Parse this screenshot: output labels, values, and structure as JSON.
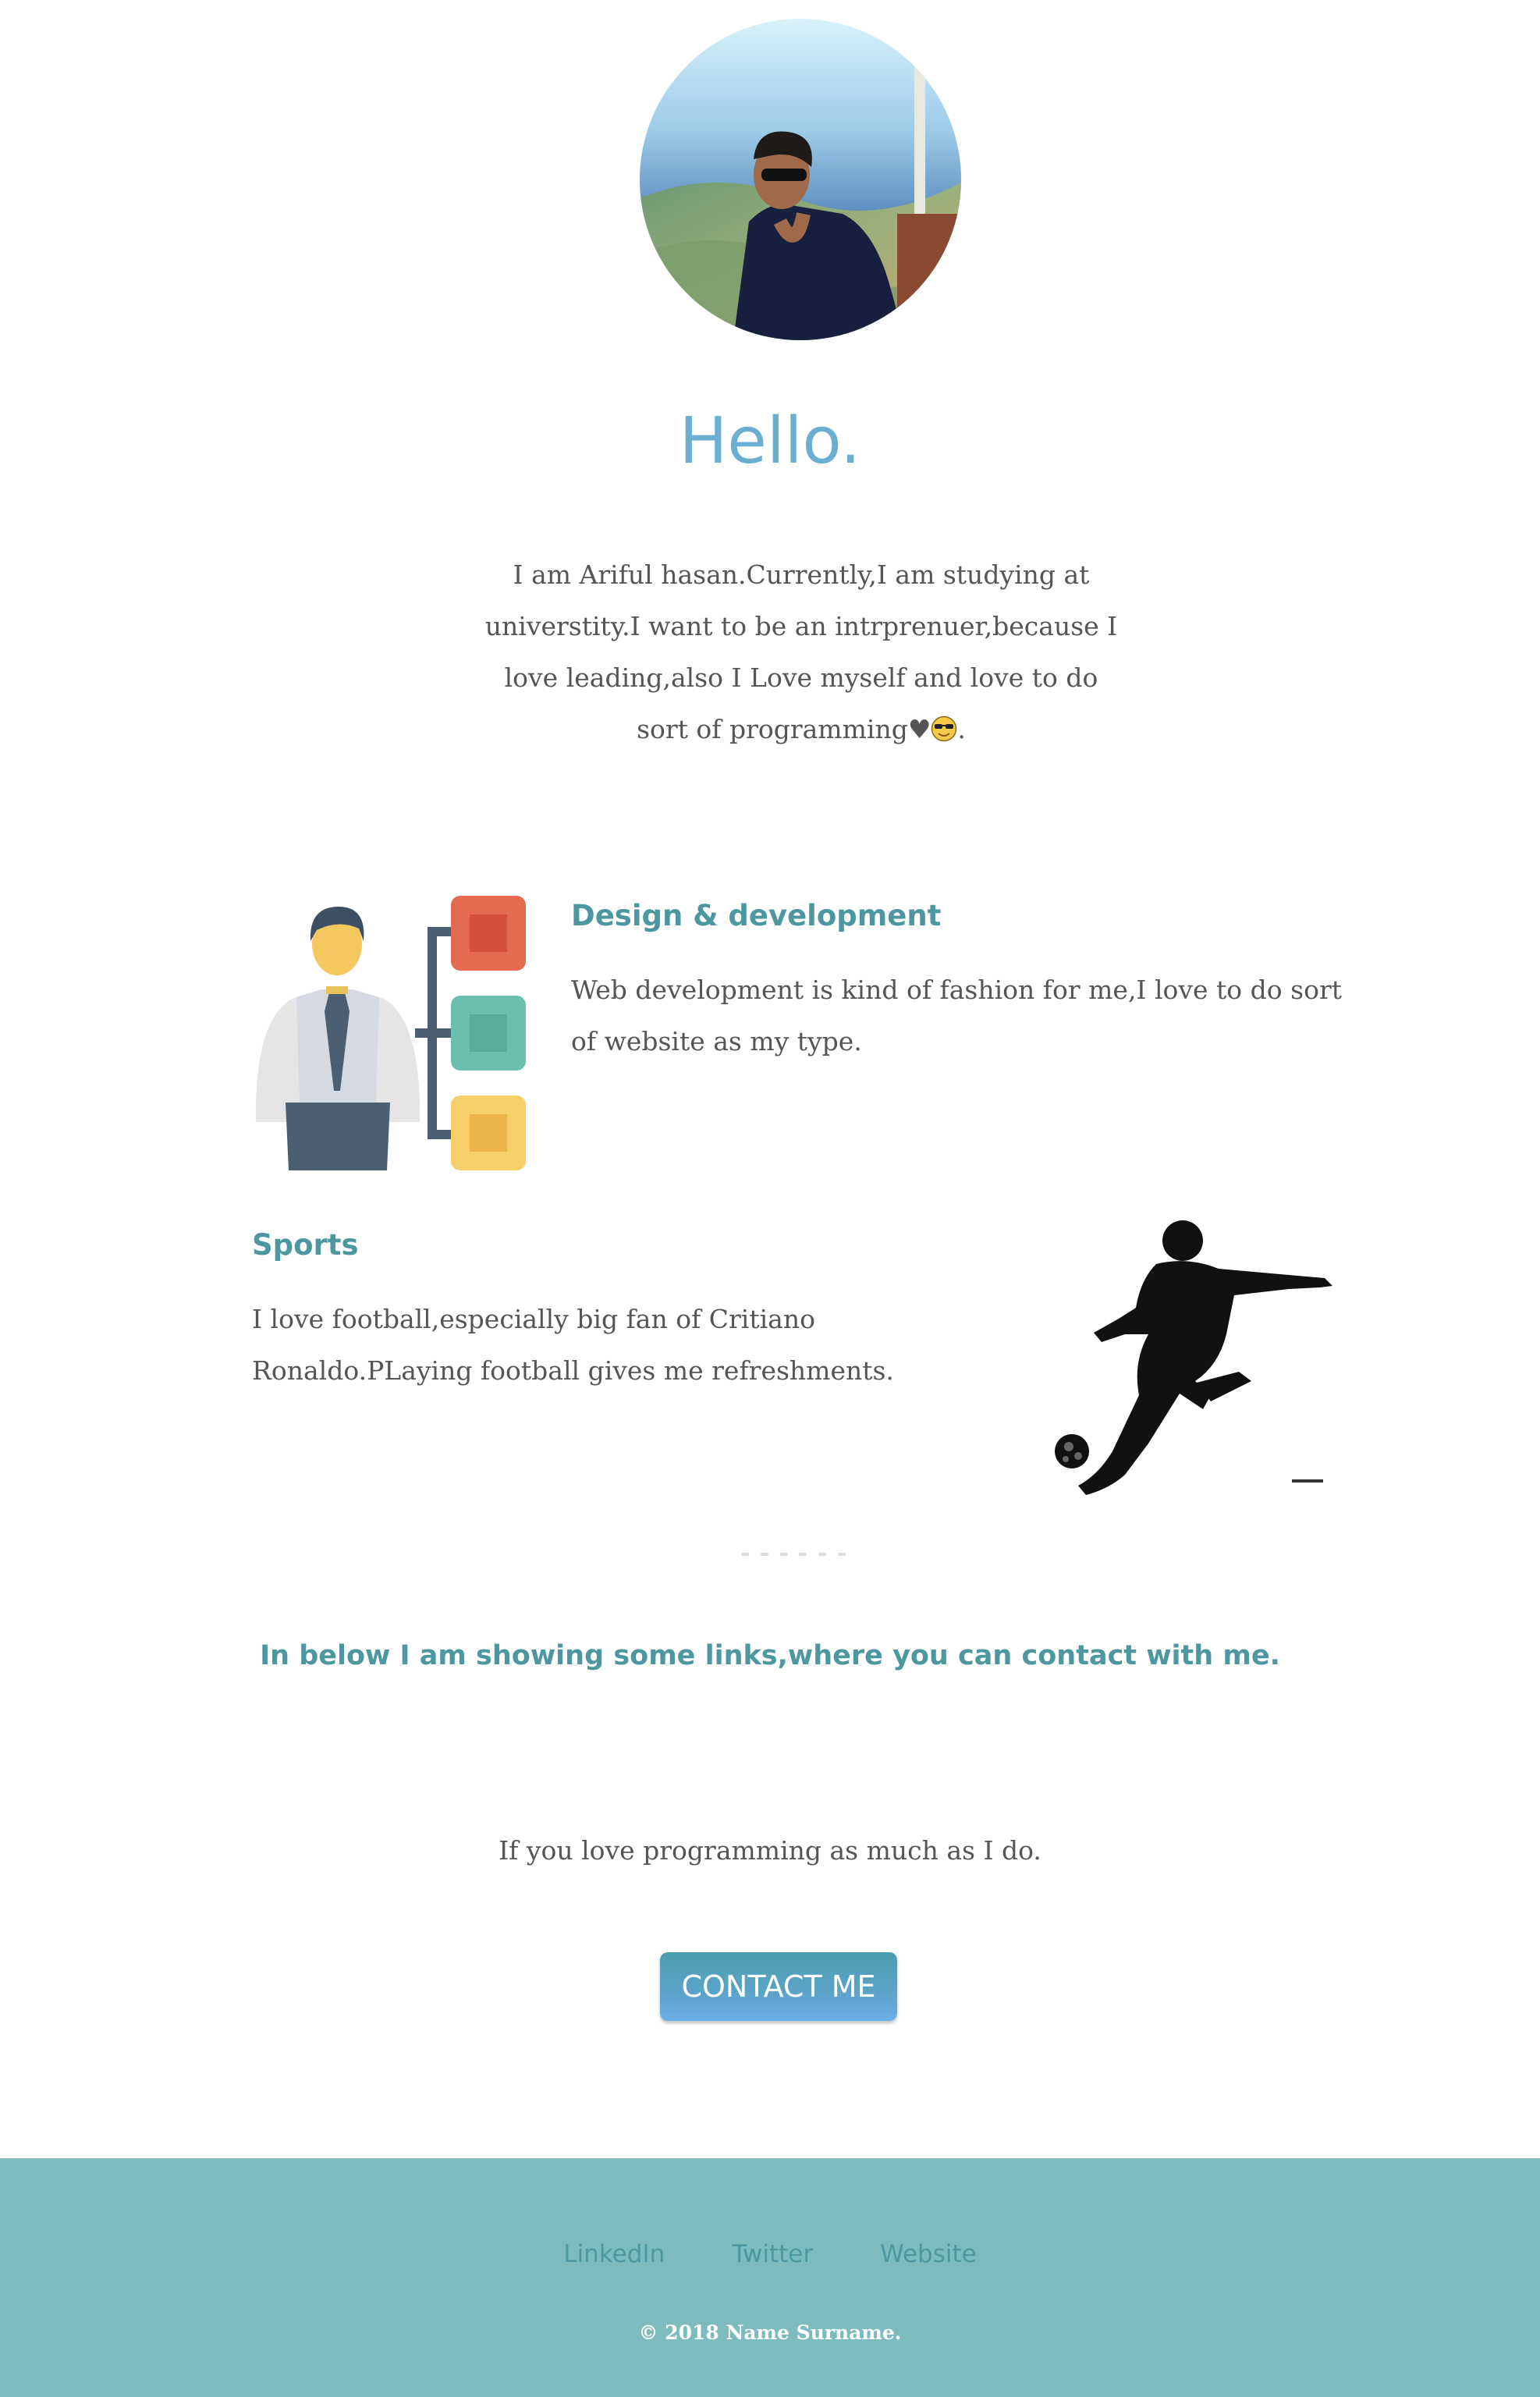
{
  "profile": {
    "photo_alt": "Profile photo",
    "heading": "Hello.",
    "bio": "I am Ariful hasan.Currently,I am studying at universtity.I want to be an intrprenuer,because I love leading,also I Love myself and love to do sort of programming",
    "bio_heart": "♥",
    "bio_end": "."
  },
  "features": {
    "design": {
      "title": "Design & development",
      "text": "Web development is kind of fashion for me,I love to do sort of website as my type."
    },
    "sports": {
      "title": "Sports",
      "text": "I love football,especially big fan of Critiano Ronaldo.PLaying football gives me refreshments."
    }
  },
  "contact": {
    "links_heading": "In below I am showing some links,where you can contact with me.",
    "love_text": "If you love programming as much as I do.",
    "button_label": "CONTACT ME"
  },
  "footer": {
    "links": [
      "LinkedIn",
      "Twitter",
      "Website"
    ],
    "copyright": "© 2018 Name Surname."
  },
  "colors": {
    "accent": "#4d97a1",
    "heading": "#6aaed0",
    "footer_bg": "#7dbbbe",
    "button": "#5aa3c6"
  },
  "icons": {
    "design": "businessman-flowchart-icon",
    "sports": "footballer-silhouette-icon",
    "emoji": "sunglasses-emoji-icon"
  }
}
